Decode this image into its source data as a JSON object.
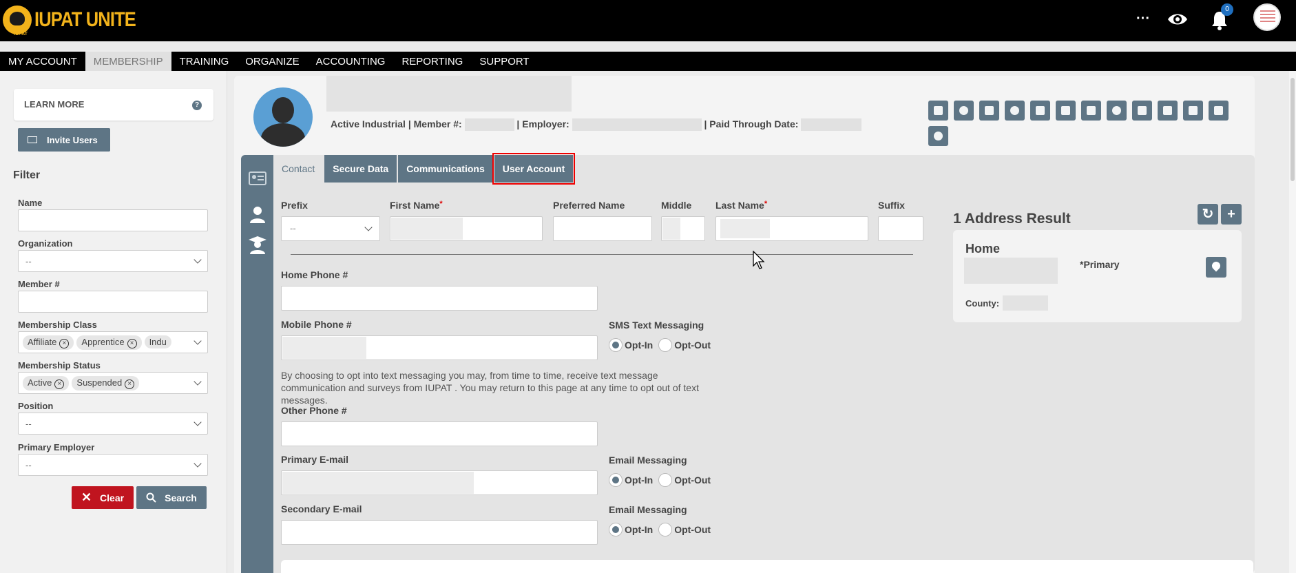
{
  "app": {
    "name": "IUPAT UNITE",
    "logo_sub": "IUPAT"
  },
  "header": {
    "more": "···",
    "notifications_count": "0"
  },
  "nav": {
    "items": [
      "MY ACCOUNT",
      "MEMBERSHIP",
      "TRAINING",
      "ORGANIZE",
      "ACCOUNTING",
      "REPORTING",
      "SUPPORT"
    ],
    "active": "MEMBERSHIP"
  },
  "sidebar": {
    "learn_more": "LEARN MORE",
    "invite_users": "Invite Users",
    "filter_title": "Filter",
    "fields": {
      "name_label": "Name",
      "organization_label": "Organization",
      "organization_value": "--",
      "member_label": "Member #",
      "membership_class_label": "Membership Class",
      "membership_class_tags": [
        "Affiliate",
        "Apprentice",
        "Indu"
      ],
      "membership_status_label": "Membership Status",
      "membership_status_tags": [
        "Active",
        "Suspended"
      ],
      "position_label": "Position",
      "position_value": "--",
      "primary_employer_label": "Primary Employer",
      "primary_employer_value": "--"
    },
    "clear": "Clear",
    "search": "Search"
  },
  "profile": {
    "status": "Active Industrial",
    "member_label": "| Member #:",
    "employer_label": "| Employer:",
    "paid_through_label": "| Paid Through Date:"
  },
  "tabs": [
    "Contact",
    "Secure Data",
    "Communications",
    "User Account"
  ],
  "contact": {
    "prefix_label": "Prefix",
    "prefix_value": "--",
    "first_name_label": "First Name",
    "preferred_name_label": "Preferred Name",
    "middle_label": "Middle",
    "last_name_label": "Last Name",
    "suffix_label": "Suffix",
    "home_phone_label": "Home Phone #",
    "mobile_phone_label": "Mobile Phone #",
    "sms_label": "SMS Text Messaging",
    "opt_in": "Opt-In",
    "opt_out": "Opt-Out",
    "sms_note": "By choosing to opt into text messaging you may, from time to time, receive text message communication and surveys from IUPAT . You may return to this page at any time to opt out of text messages.",
    "other_phone_label": "Other Phone #",
    "primary_email_label": "Primary E-mail",
    "email_messaging_label": "Email Messaging",
    "secondary_email_label": "Secondary E-mail",
    "email_messaging_label_2": "Email Messaging"
  },
  "address": {
    "title": "1 Address Result",
    "home": "Home",
    "primary": "*Primary",
    "county_label": "County:"
  },
  "colors": {
    "accent": "#5e7585",
    "danger": "#c0141f",
    "brand": "#f2b31b"
  }
}
